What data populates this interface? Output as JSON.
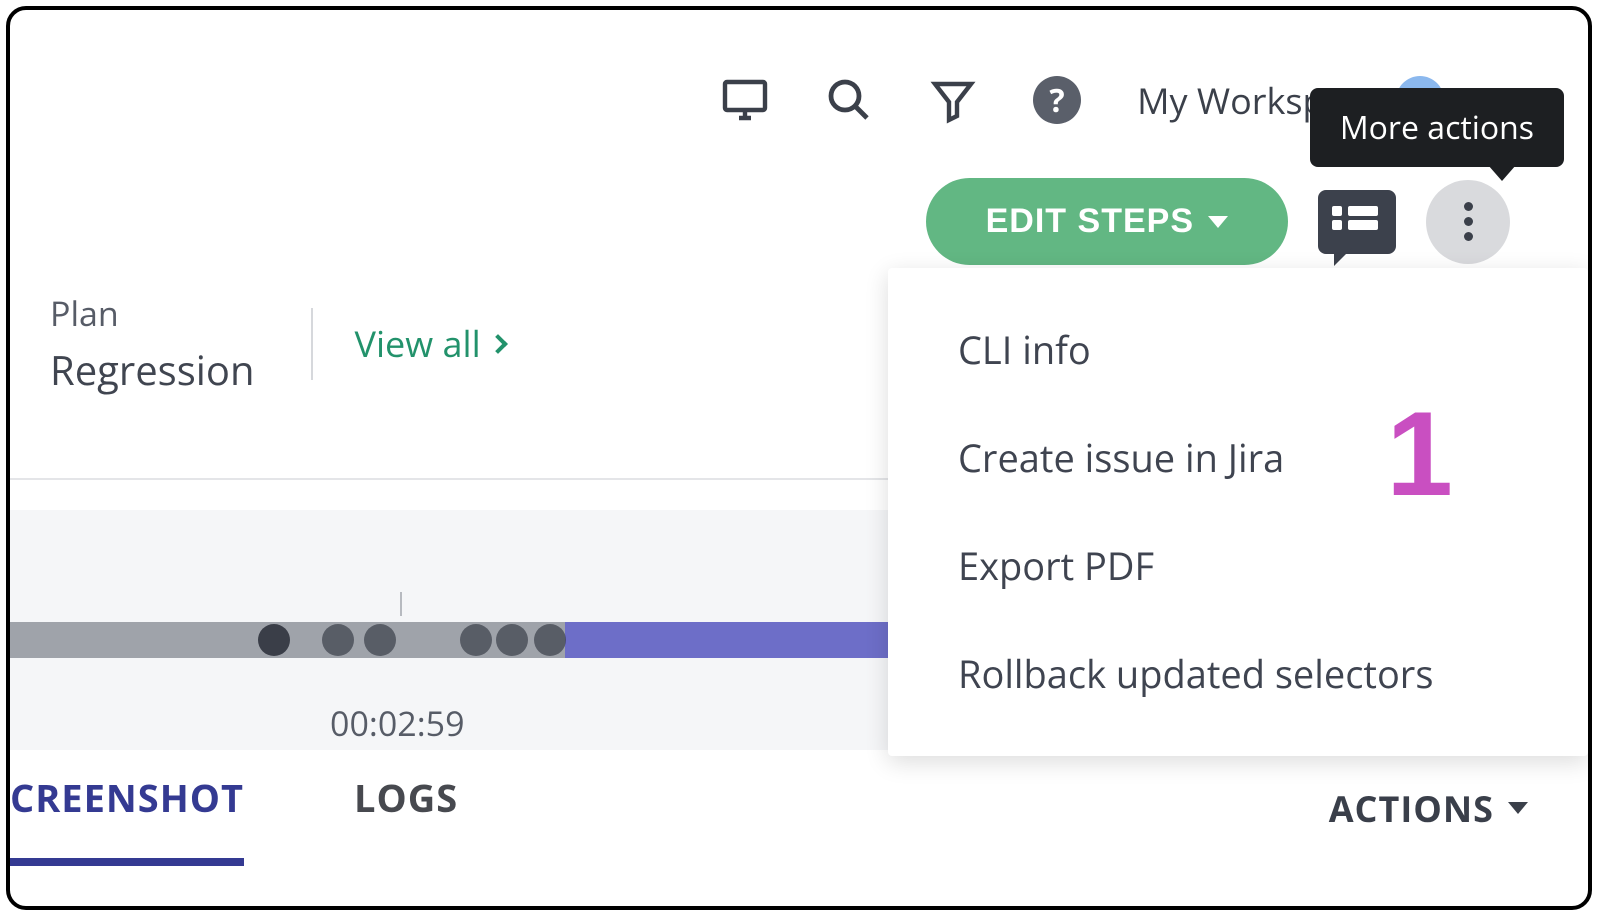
{
  "topbar": {
    "workspace_label": "My Workspace"
  },
  "tooltip": {
    "more_actions": "More actions"
  },
  "action_row": {
    "edit_steps_label": "EDIT STEPS"
  },
  "info": {
    "plan_label": "Plan",
    "plan_value": "Regression",
    "view_all_label": "View all"
  },
  "timeline": {
    "time_label": "00:02:59"
  },
  "menu": {
    "items": [
      "CLI info",
      "Create issue in Jira",
      "Export PDF",
      "Rollback updated selectors"
    ]
  },
  "callout": {
    "one": "1"
  },
  "tabs": {
    "screenshot": "CREENSHOT",
    "logs": "LOGS",
    "actions_label": "ACTIONS"
  }
}
